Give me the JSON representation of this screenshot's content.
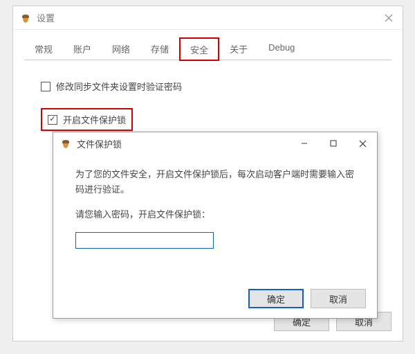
{
  "settings_window": {
    "title": "设置",
    "tabs": {
      "general": "常规",
      "account": "账户",
      "network": "网络",
      "storage": "存储",
      "security": "安全",
      "about": "关于",
      "debug": "Debug"
    },
    "checkbox1_label": "修改同步文件夹设置时验证密码",
    "checkbox1_checked": false,
    "checkbox2_label": "开启文件保护锁",
    "checkbox2_checked": true,
    "ok_button": "确定",
    "cancel_button": "取消"
  },
  "modal": {
    "title": "文件保护锁",
    "description": "为了您的文件安全，开启文件保护锁后，每次启动客户端时需要输入密码进行验证。",
    "prompt": "请您输入密码，开启文件保护锁：",
    "password_value": "",
    "ok_button": "确定",
    "cancel_button": "取消"
  }
}
